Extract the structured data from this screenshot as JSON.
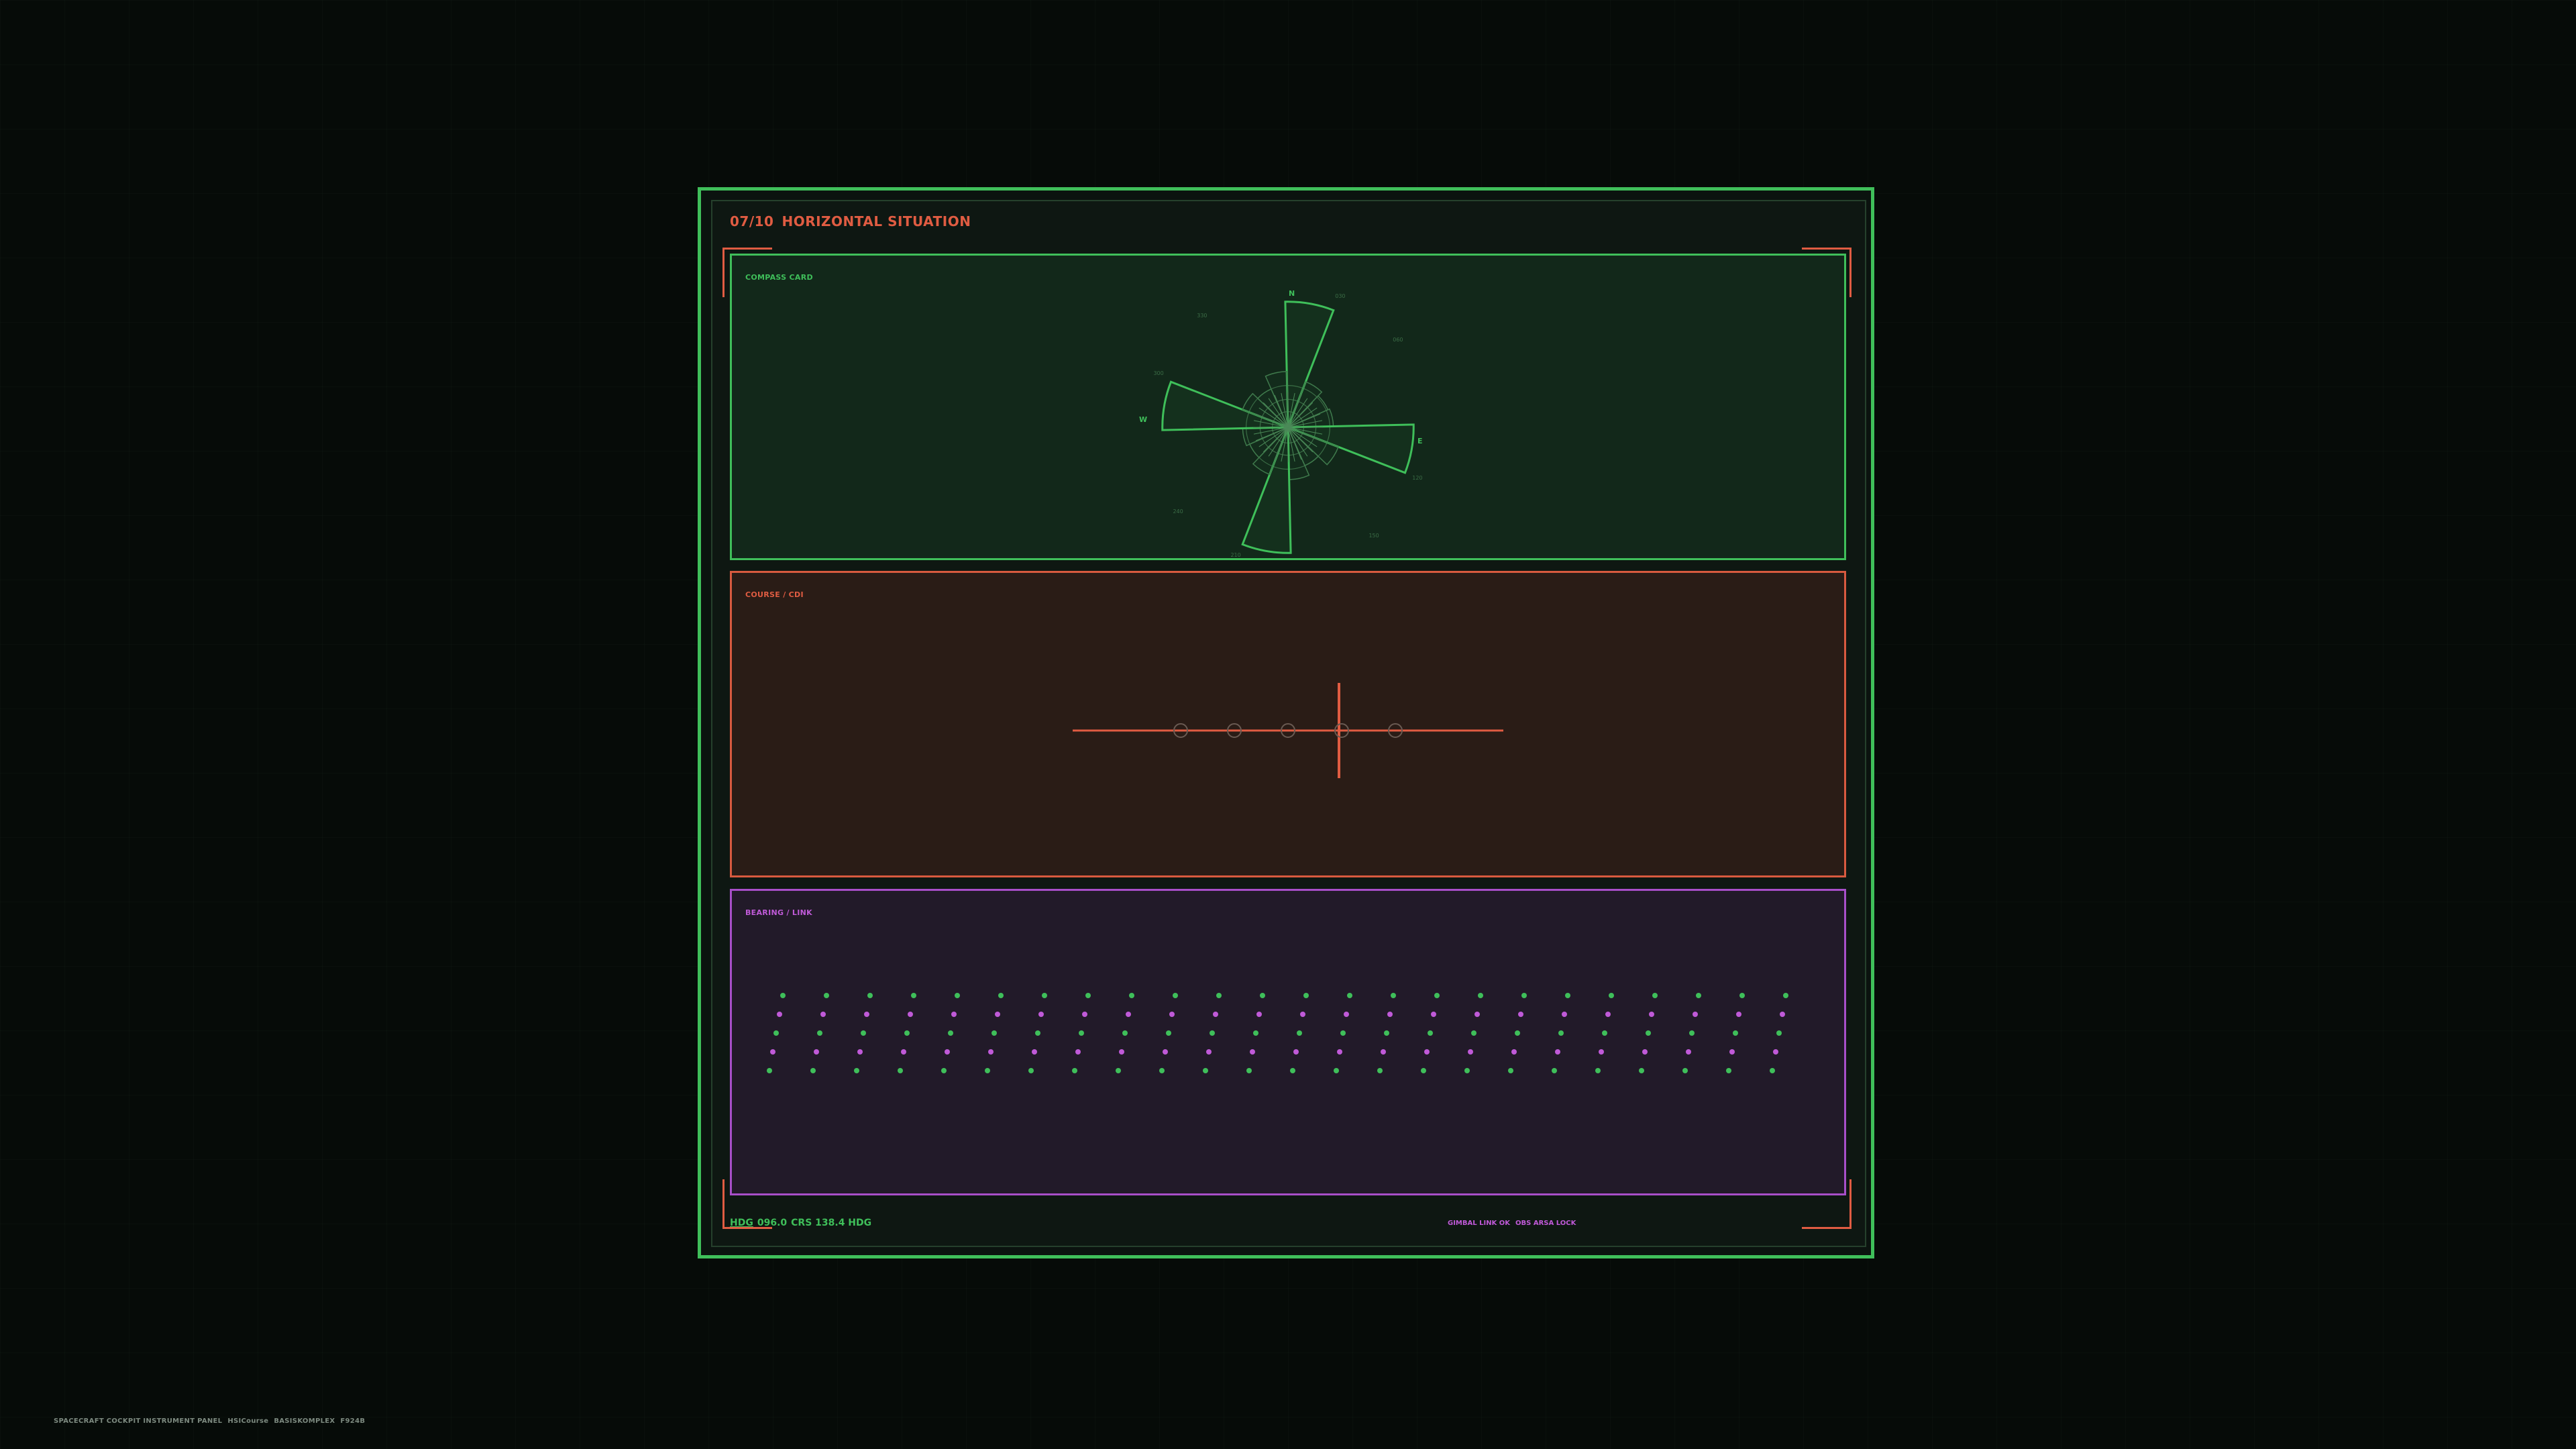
{
  "panel": {
    "index": "07/10",
    "title": "HORIZONTAL SITUATION"
  },
  "sections": {
    "compass": {
      "label": "COMPASS CARD",
      "cardinals": {
        "n": "N",
        "e": "E",
        "s": "S",
        "w": "W"
      },
      "tick_labels": [
        "030",
        "060",
        "120",
        "150",
        "210",
        "240",
        "300",
        "330"
      ],
      "rose_lengths": [
        0.72,
        0.28,
        0.25,
        0.26,
        0.72,
        0.31,
        0.24,
        0.3,
        0.72,
        0.29,
        0.24,
        0.26,
        0.72,
        0.28,
        0.24,
        0.32
      ]
    },
    "course": {
      "label": "COURSE / CDI",
      "deviation_dots": 5
    },
    "bearing": {
      "label": "BEARING / LINK",
      "rows": 5,
      "cols": 24,
      "row_colors": [
        "#3fbf5a",
        "#c05ad8",
        "#3fbf5a",
        "#c05ad8",
        "#3fbf5a"
      ]
    }
  },
  "footer": {
    "hdg_label": "HDG",
    "hdg_value": "096.0",
    "crs": "CRS 138.4 HDG",
    "status1": "GIMBAL LINK OK",
    "status2": "OBS ARSA LOCK"
  },
  "caption": {
    "part1": "SPACECRAFT COCKPIT INSTRUMENT PANEL",
    "part2": "HSICourse",
    "part3": "BASISKOMPLEX",
    "part4": "F924B"
  },
  "colors": {
    "green": "#3fbf5a",
    "orange": "#e05c42",
    "purple": "#c05ad8"
  }
}
